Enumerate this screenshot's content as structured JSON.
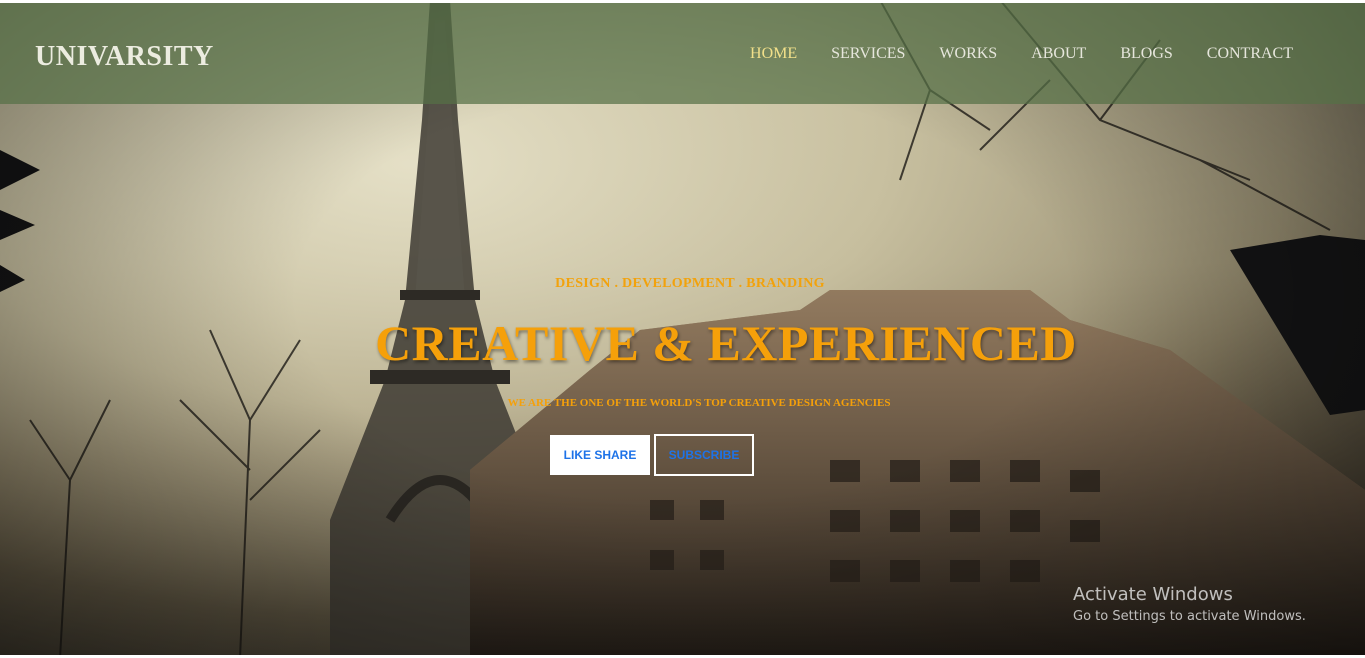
{
  "header": {
    "logo": "UNIVARSITY",
    "nav": [
      {
        "label": "HOME",
        "active": true
      },
      {
        "label": "SERVICES",
        "active": false
      },
      {
        "label": "WORKS",
        "active": false
      },
      {
        "label": "ABOUT",
        "active": false
      },
      {
        "label": "BLOGS",
        "active": false
      },
      {
        "label": "CONTRACT",
        "active": false
      }
    ]
  },
  "hero": {
    "tagline": "DESIGN . DEVELOPMENT . BRANDING",
    "headline": "CREATIVE & EXPERIENCED",
    "subline": "WE ARE THE ONE OF THE WORLD'S TOP CREATIVE DESIGN AGENCIES",
    "buttons": {
      "like_share": "LIKE SHARE",
      "subscribe": "SUBSCRIBE"
    }
  },
  "watermark": {
    "title": "Activate Windows",
    "subtitle": "Go to Settings to activate Windows."
  },
  "colors": {
    "accent": "#f5a00a",
    "nav_bar": "#567046",
    "nav_active": "#f2e08a",
    "button_text": "#1e73e8"
  }
}
